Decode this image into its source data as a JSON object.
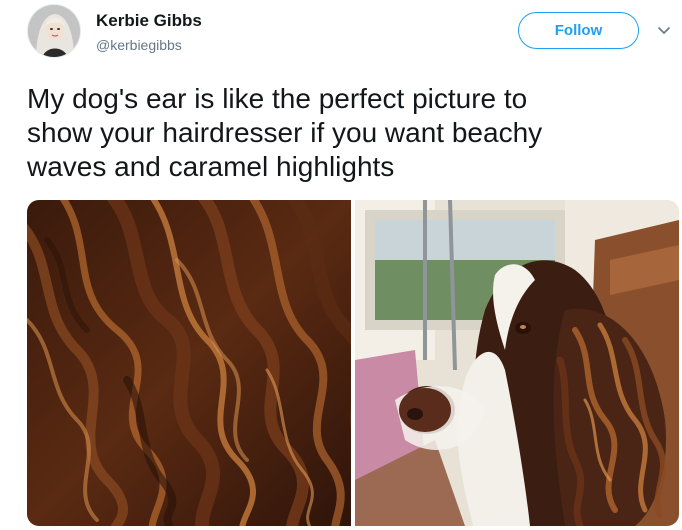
{
  "user": {
    "display_name": "Kerbie Gibbs",
    "handle": "@kerbiegibbs",
    "avatar_icon": "profile-avatar-photo"
  },
  "actions": {
    "follow_label": "Follow",
    "more_icon": "chevron-down-icon"
  },
  "tweet": {
    "text": "My dog's ear is like the perfect picture to\nshow your hairdresser if you want beachy\nwaves and caramel highlights"
  },
  "media": {
    "photos": [
      {
        "subject": "wavy brunette hair with caramel highlights"
      },
      {
        "subject": "springer spaniel with wavy ear"
      }
    ]
  },
  "colors": {
    "accent": "#1da1f2",
    "text": "#14171a",
    "secondary_text": "#657786"
  }
}
